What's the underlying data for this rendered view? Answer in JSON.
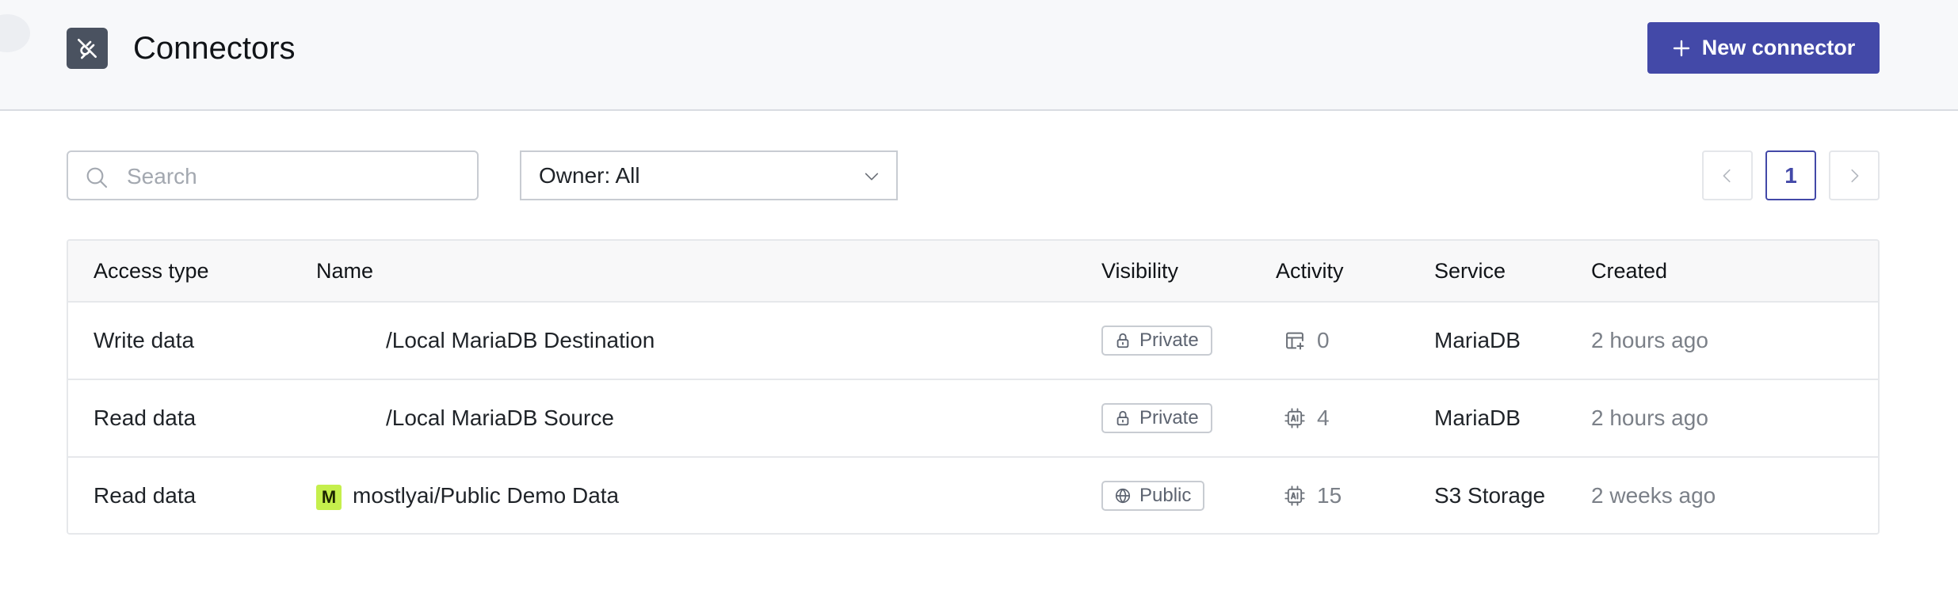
{
  "header": {
    "title": "Connectors",
    "new_button_label": "New connector"
  },
  "filters": {
    "search_placeholder": "Search",
    "search_value": "",
    "owner_label": "Owner: All"
  },
  "pagination": {
    "current_page": "1"
  },
  "table": {
    "columns": [
      "Access type",
      "Name",
      "Visibility",
      "Activity",
      "Service",
      "Created"
    ],
    "rows": [
      {
        "access_type": "Write data",
        "owner_badge": "",
        "name": "/Local MariaDB Destination",
        "visibility": "Private",
        "visibility_icon": "lock-icon",
        "activity_icon": "table-add-icon",
        "activity_count": "0",
        "service": "MariaDB",
        "created": "2 hours ago"
      },
      {
        "access_type": "Read data",
        "owner_badge": "",
        "name": "/Local MariaDB Source",
        "visibility": "Private",
        "visibility_icon": "lock-icon",
        "activity_icon": "ai-chip-icon",
        "activity_count": "4",
        "service": "MariaDB",
        "created": "2 hours ago"
      },
      {
        "access_type": "Read data",
        "owner_badge": "M",
        "name": "mostlyai/Public Demo Data",
        "visibility": "Public",
        "visibility_icon": "globe-icon",
        "activity_icon": "ai-chip-icon",
        "activity_count": "15",
        "service": "S3 Storage",
        "created": "2 weeks ago"
      }
    ]
  },
  "colors": {
    "primary": "#4349a8",
    "header_bg": "#f7f8fa",
    "app_icon_bg": "#4a5260",
    "owner_badge_bg": "#c5ef4c"
  }
}
